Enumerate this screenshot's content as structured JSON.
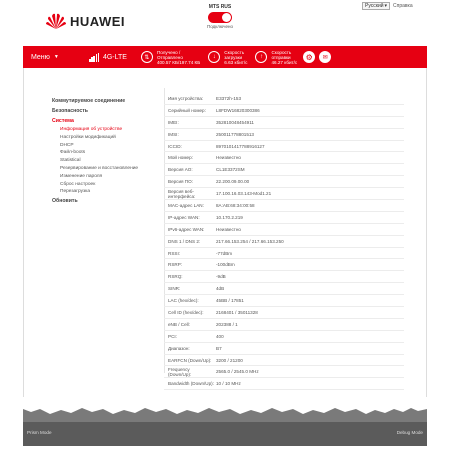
{
  "brand": {
    "name": "HUAWEI"
  },
  "carrier": {
    "name": "MTS RUS",
    "status": "Подключено"
  },
  "header": {
    "language": "Русский",
    "help": "Справка"
  },
  "navbar": {
    "menu_label": "Меню",
    "network": "4G-LTE",
    "usage": {
      "line1": "Получено /",
      "line2": "Отправлено",
      "line3": "400.57 КБ/197.74 КБ"
    },
    "download": {
      "line1": "Скорость",
      "line2": "загрузки",
      "line3": "6.63 кбит/с"
    },
    "upload": {
      "line1": "Скорость",
      "line2": "отправки",
      "line3": "46.27 кбит/с"
    }
  },
  "sidebar": {
    "items": [
      {
        "label": "Коммутируемое соединение",
        "type": "head"
      },
      {
        "label": "Безопасность",
        "type": "head"
      },
      {
        "label": "Система",
        "type": "head",
        "active": true
      },
      {
        "label": "Информация об устройстве",
        "type": "sub",
        "active": true
      },
      {
        "label": "Настройки модификаций",
        "type": "sub"
      },
      {
        "label": "DHCP",
        "type": "sub"
      },
      {
        "label": "Файл-boots",
        "type": "sub"
      },
      {
        "label": "Statistical",
        "type": "sub"
      },
      {
        "label": "Резервирование и восстановление",
        "type": "sub"
      },
      {
        "label": "Изменение пароля",
        "type": "sub"
      },
      {
        "label": "Сброс настроек",
        "type": "sub"
      },
      {
        "label": "Перезагрузка",
        "type": "sub"
      },
      {
        "label": "Обновить",
        "type": "head"
      }
    ]
  },
  "device_info": [
    {
      "key": "Имя устройства:",
      "value": "E3372h-153"
    },
    {
      "key": "Серийный номер:",
      "value": "L8FDW16820300386"
    },
    {
      "key": "IMEI:",
      "value": "352810048454911"
    },
    {
      "key": "IMSI:",
      "value": "250011778801513"
    },
    {
      "key": "ICCID:",
      "value": "8970101417788916127"
    },
    {
      "key": "Мой номер:",
      "value": "Неизвестно"
    },
    {
      "key": "Версия АО:",
      "value": "CL1E3372SM"
    },
    {
      "key": "Версия ПО:",
      "value": "22.200.09.00.00"
    },
    {
      "key": "Версия веб-интерфейса:",
      "value": "17.100.16.03.143-Mod1.21"
    },
    {
      "key": "MAC-адрес LAN:",
      "value": "8A:AB:68:34:00:58"
    },
    {
      "key": "IP-адрес WAN:",
      "value": "10.170.2.219"
    },
    {
      "key": "IPv6-адрес WAN:",
      "value": "Неизвестно"
    },
    {
      "key": "DNS 1 / DNS 2:",
      "value": "217.66.153.254 / 217.66.153.250"
    },
    {
      "key": "RSSI:",
      "value": "-77dBm"
    },
    {
      "key": "RSRP:",
      "value": "-100dBm"
    },
    {
      "key": "RSRQ:",
      "value": "-9dB"
    },
    {
      "key": "SINR:",
      "value": "4dB"
    },
    {
      "key": "LAC (hex/dec):",
      "value": "45BB / 17851"
    },
    {
      "key": "Cell ID (hex/dec):",
      "value": "2168401 / 35011328"
    },
    {
      "key": "eNB / Cell:",
      "value": "202388 / 1"
    },
    {
      "key": "PCI:",
      "value": "400"
    },
    {
      "key": "Диапазон:",
      "value": "B7"
    },
    {
      "key": "EARFCN (Down/Up):",
      "value": "3200 / 21200"
    },
    {
      "key": "Frequency (Down/Up):",
      "value": "2565.0 / 2545.0 MHz"
    },
    {
      "key": "Bandwidth (Down/Up):",
      "value": "10 / 10 MHz"
    }
  ],
  "footer": {
    "left": "Prism Mode",
    "right": "Debug Mode"
  },
  "colors": {
    "accent": "#e60012",
    "footer": "#5b5b5b"
  }
}
